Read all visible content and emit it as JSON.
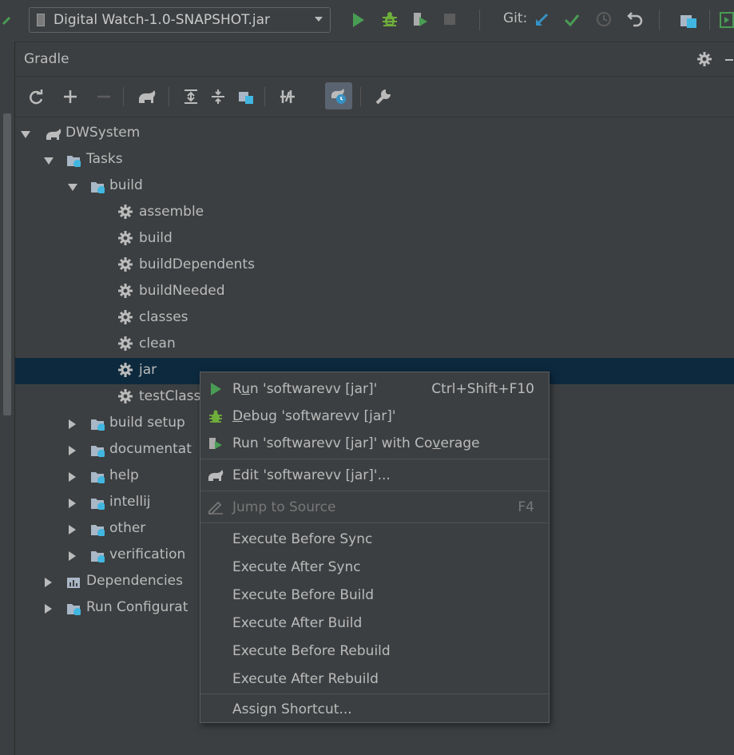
{
  "toolbar": {
    "config_name": "Digital Watch-1.0-SNAPSHOT.jar",
    "git_label": "Git:"
  },
  "panel": {
    "title": "Gradle"
  },
  "tree": {
    "root": "DWSystem",
    "tasks": "Tasks",
    "build_group": "build",
    "build_tasks": [
      "assemble",
      "build",
      "buildDependents",
      "buildNeeded",
      "classes",
      "clean",
      "jar",
      "testClass"
    ],
    "groups": [
      "build setup",
      "documentat",
      "help",
      "intellij",
      "other",
      "verification"
    ],
    "dependencies": "Dependencies",
    "run_configurations": "Run Configurat"
  },
  "menu": {
    "items": [
      {
        "mnemonic_pre": "R",
        "mnemonic": "u",
        "rest": "n 'softwarevv [jar]'",
        "shortcut": "Ctrl+Shift+F10"
      },
      {
        "mnemonic_pre": "",
        "mnemonic": "D",
        "rest": "ebug 'softwarevv [jar]'",
        "shortcut": ""
      },
      {
        "mnemonic_pre": "Run 'softwarevv [jar]' with Co",
        "mnemonic": "v",
        "rest": "erage",
        "shortcut": ""
      },
      {
        "label": "Edit 'softwarevv [jar]'..."
      },
      {
        "label": "Jump to Source",
        "shortcut": "F4"
      },
      {
        "label": "Execute Before Sync"
      },
      {
        "label": "Execute After Sync"
      },
      {
        "label": "Execute Before Build"
      },
      {
        "label": "Execute After Build"
      },
      {
        "label": "Execute Before Rebuild"
      },
      {
        "label": "Execute After Rebuild"
      },
      {
        "label": "Assign Shortcut..."
      }
    ]
  },
  "colors": {
    "run_green": "#499c54",
    "debug_green": "#6fae3b",
    "git_blue": "#3592c4",
    "folder_blue": "#40b6e0",
    "selection": "#0d293e"
  }
}
